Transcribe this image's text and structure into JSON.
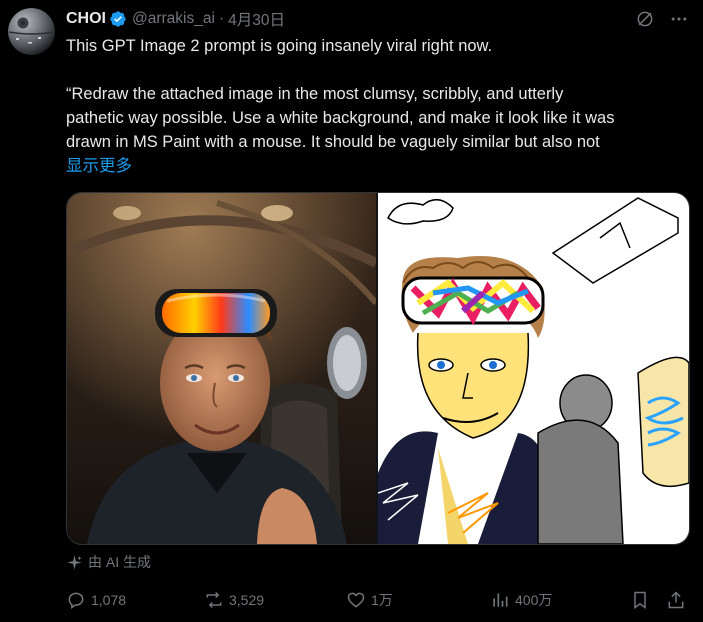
{
  "author": {
    "name": "CHOI",
    "handle": "@arrakis_ai",
    "separator": "·",
    "date": "4月30日",
    "verified": true,
    "avatar_icon": "death-star-avatar"
  },
  "post": {
    "line1": "This GPT Image 2 prompt is going insanely viral right now.",
    "line2": "“Redraw the attached image in the most clumsy, scribbly, and utterly",
    "line3": "pathetic way possible. Use a white background, and make it look like it was",
    "line4": "drawn in MS Paint with a mouse. It should be vaguely similar but also not",
    "show_more": "显示更多"
  },
  "media": {
    "left_image": "photo-man-with-ski-goggles-in-jet",
    "right_image": "scribbly-ms-paint-redraw"
  },
  "ai_label": "由 AI 生成",
  "metrics": {
    "replies": "1,078",
    "reposts": "3,529",
    "likes": "1万",
    "views": "400万"
  },
  "colors": {
    "background": "#000000",
    "text": "#e7e9ea",
    "muted": "#71767b",
    "accent": "#1d9bf0"
  }
}
